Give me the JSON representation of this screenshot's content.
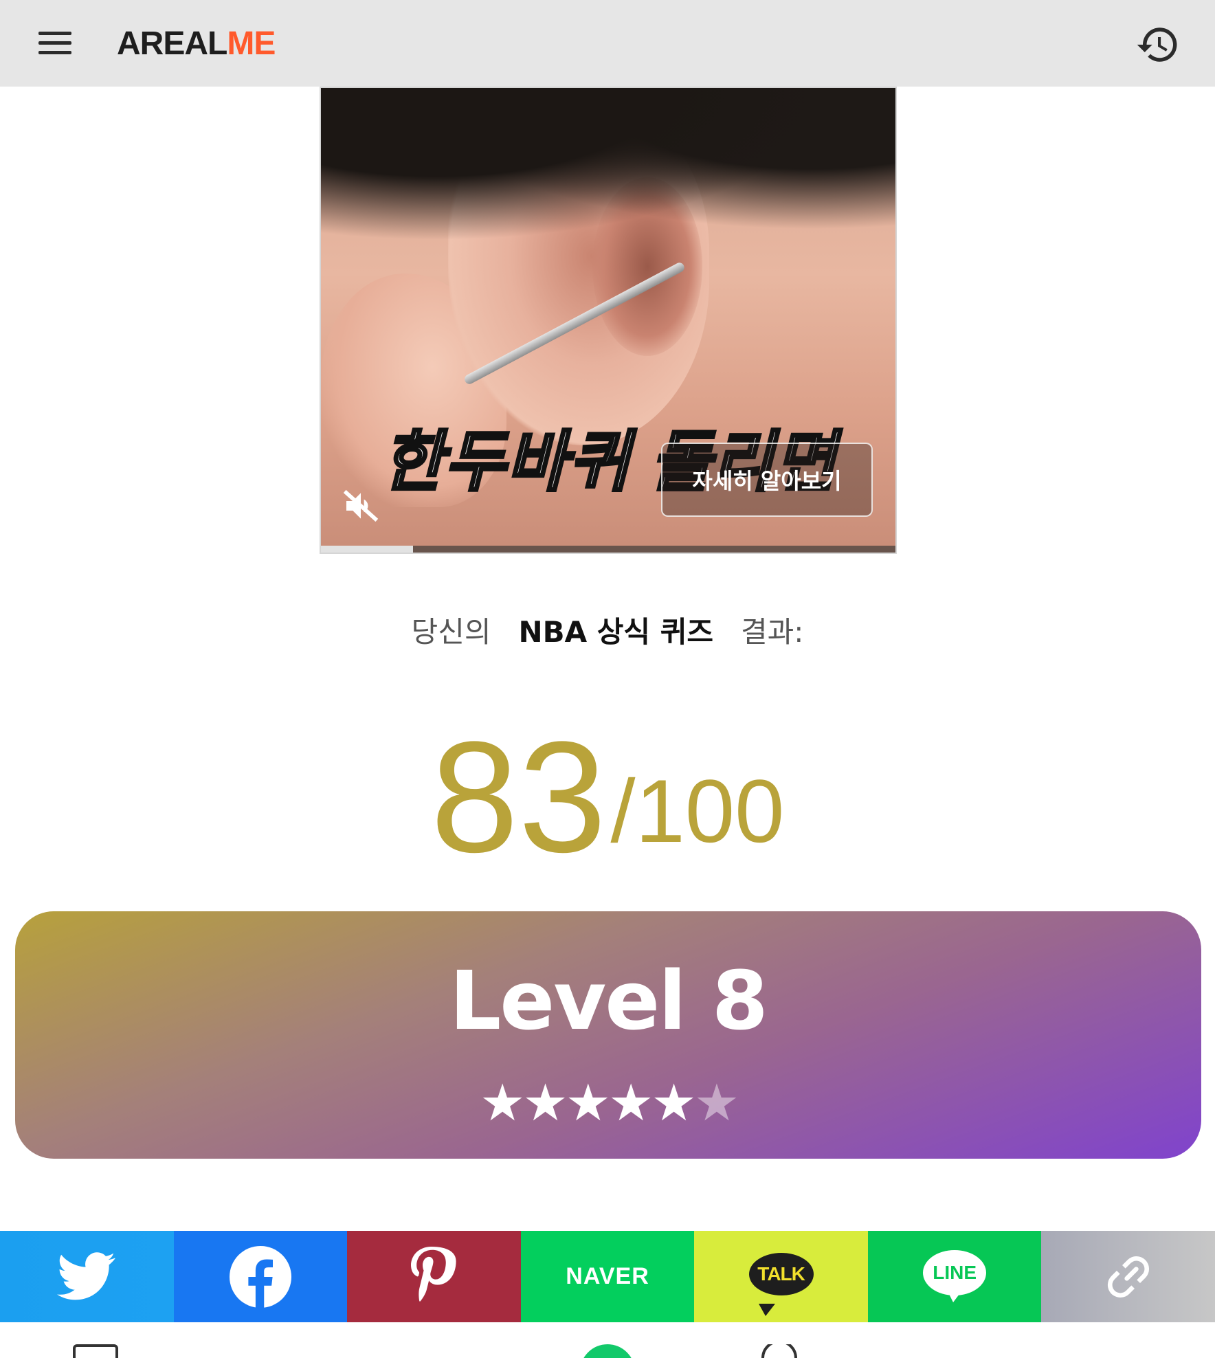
{
  "header": {
    "logo_part1": "AREAL",
    "logo_part2": "ME",
    "menu_icon": "hamburger-menu-icon",
    "history_icon": "history-icon"
  },
  "ad": {
    "subtitle": "한두바퀴 돌리면",
    "cta_label": "자세히 알아보기",
    "mute_icon": "volume-muted-icon",
    "progress": 0.16
  },
  "result": {
    "prefix": "당신의",
    "quiz_name": "NBA 상식 퀴즈",
    "suffix": "결과:"
  },
  "score": {
    "value": "83",
    "slash": "/",
    "max": "100"
  },
  "level": {
    "title": "Level 8",
    "stars_filled": 5,
    "stars_total": 6,
    "gradient": [
      "#b7a13c",
      "#8043cd"
    ]
  },
  "share": {
    "naver_label": "NAVER",
    "kakao_label": "TALK",
    "line_label": "LINE",
    "buttons": [
      "twitter",
      "facebook",
      "pinterest",
      "naver",
      "kakaotalk",
      "line",
      "copy-link"
    ]
  },
  "colors": {
    "score_gold": "#b9a33a",
    "brand_orange": "#ff5a2c"
  }
}
